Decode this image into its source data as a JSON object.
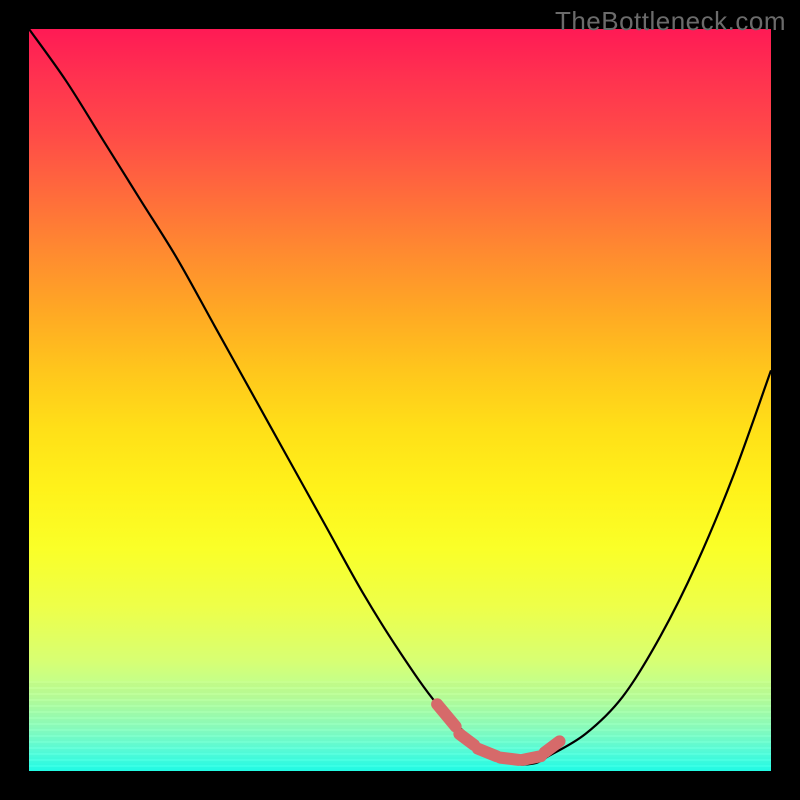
{
  "watermark": "TheBottleneck.com",
  "chart_data": {
    "type": "line",
    "title": "",
    "xlabel": "",
    "ylabel": "",
    "xlim": [
      0,
      100
    ],
    "ylim": [
      0,
      100
    ],
    "series": [
      {
        "name": "bottleneck-curve",
        "x": [
          0,
          5,
          10,
          15,
          20,
          25,
          30,
          35,
          40,
          45,
          50,
          55,
          60,
          62,
          65,
          68,
          70,
          75,
          80,
          85,
          90,
          95,
          100
        ],
        "values": [
          100,
          93,
          85,
          77,
          69,
          60,
          51,
          42,
          33,
          24,
          16,
          9,
          4,
          2,
          1,
          1,
          2,
          5,
          10,
          18,
          28,
          40,
          54
        ]
      }
    ],
    "highlight": {
      "name": "optimal-range-marker",
      "color": "#d66a6a",
      "segments": [
        {
          "x": [
            55,
            57.5
          ],
          "values": [
            9,
            6
          ]
        },
        {
          "x": [
            58,
            60
          ],
          "values": [
            5,
            3.5
          ]
        },
        {
          "x": [
            60.5,
            63
          ],
          "values": [
            3,
            2
          ]
        },
        {
          "x": [
            63.5,
            66
          ],
          "values": [
            1.8,
            1.5
          ]
        },
        {
          "x": [
            66.5,
            69
          ],
          "values": [
            1.5,
            2
          ]
        },
        {
          "x": [
            69.5,
            71.5
          ],
          "values": [
            2.5,
            4
          ]
        }
      ]
    },
    "background_gradient": [
      "#ff1a55",
      "#ffe018",
      "#22ffe8"
    ]
  }
}
